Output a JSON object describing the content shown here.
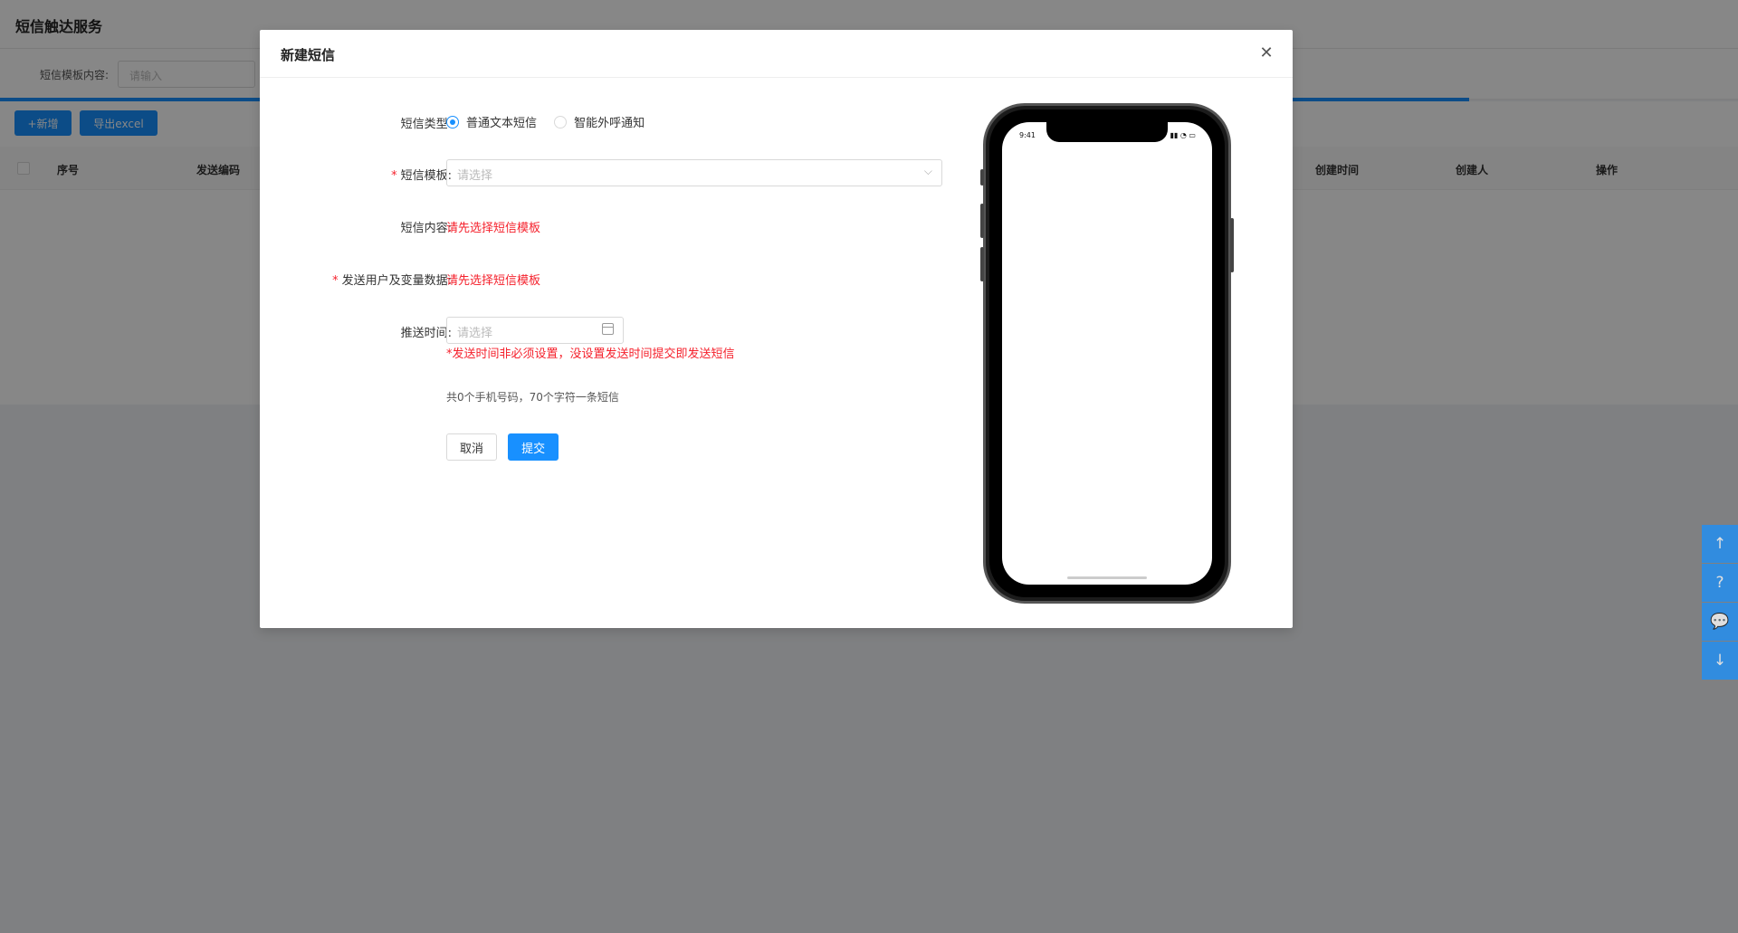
{
  "background": {
    "page_title": "短信触达服务",
    "search": {
      "label": "短信模板内容:",
      "placeholder": "请输入"
    },
    "toolbar": {
      "add_label": "+新增",
      "export_label": "导出excel"
    },
    "table": {
      "columns": [
        "序号",
        "发送编码",
        "创建时间",
        "创建人",
        "操作"
      ]
    }
  },
  "float_tools": [
    "arrow-up-icon",
    "help-icon",
    "chat-icon",
    "arrow-down-icon"
  ],
  "modal": {
    "title": "新建短信",
    "close_symbol": "✕",
    "form": {
      "sms_type": {
        "label": "短信类型:",
        "options": [
          "普通文本短信",
          "智能外呼通知"
        ],
        "selected": "普通文本短信"
      },
      "template": {
        "label": "短信模板:",
        "placeholder": "请选择",
        "required": true
      },
      "content": {
        "label": "短信内容:",
        "value": "请先选择短信模板"
      },
      "users": {
        "label": "发送用户及变量数据:",
        "value": "请先选择短信模板",
        "required": true
      },
      "push_time": {
        "label": "推送时间:",
        "placeholder": "请选择",
        "note": "*发送时间非必须设置，没设置发送时间提交即发送短信"
      },
      "summary": "共0个手机号码，70个字符一条短信",
      "cancel_label": "取消",
      "submit_label": "提交"
    },
    "phone_preview": {
      "time": "9:41"
    }
  },
  "colors": {
    "primary": "#1890ff",
    "danger": "#f5222d",
    "mask": "rgba(0,0,0,0.47)"
  }
}
